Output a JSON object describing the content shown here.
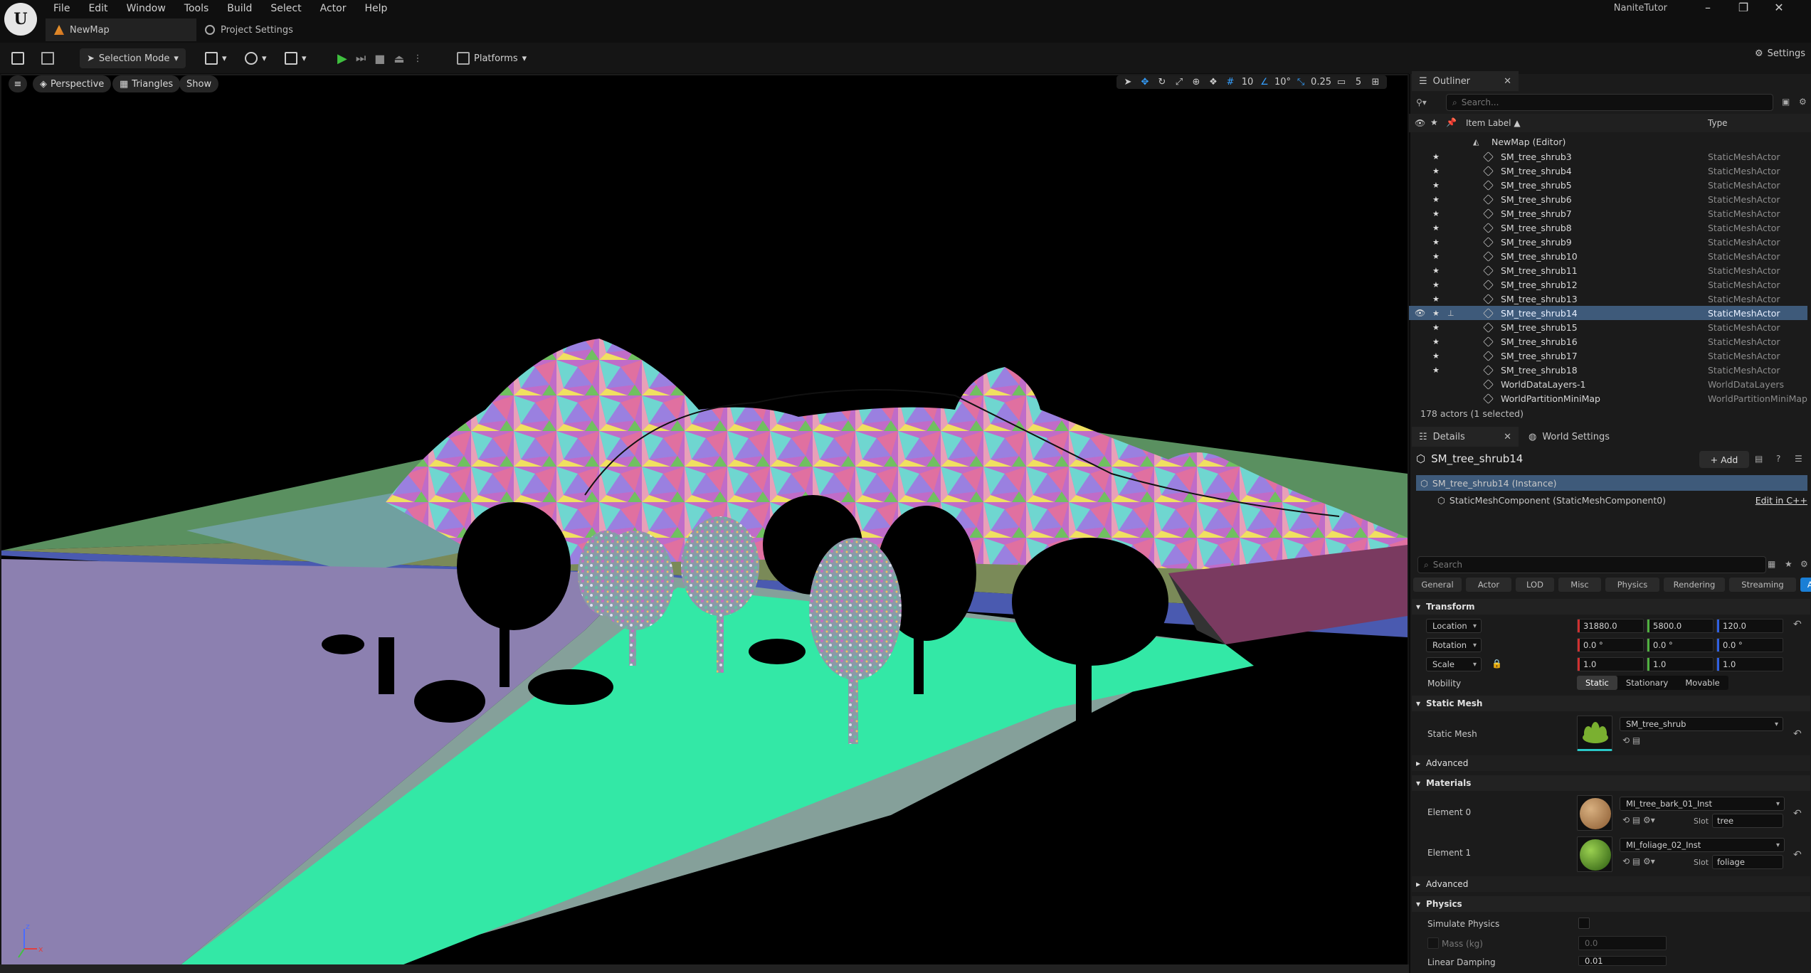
{
  "menu": [
    "File",
    "Edit",
    "Window",
    "Tools",
    "Build",
    "Select",
    "Actor",
    "Help"
  ],
  "project_name": "NaniteTutor",
  "window_controls": [
    "–",
    "❐",
    "✕"
  ],
  "tabs": {
    "map": "NewMap",
    "project_settings": "Project Settings"
  },
  "toolbar": {
    "selection_mode": "Selection Mode",
    "platforms": "Platforms",
    "settings": "Settings"
  },
  "viewport": {
    "perspective": "Perspective",
    "view_mode": "Triangles",
    "show": "Show",
    "grid_snap": "10",
    "rot_snap": "10°",
    "scale_snap": "0.25",
    "cam_speed": "5",
    "axis_z": "z",
    "axis_x": "x"
  },
  "outliner": {
    "tab": "Outliner",
    "search_placeholder": "Search...",
    "col_label": "Item Label ▲",
    "col_type": "Type",
    "root": "NewMap (Editor)",
    "rows": [
      {
        "label": "SM_tree_shrub3",
        "type": "StaticMeshActor"
      },
      {
        "label": "SM_tree_shrub4",
        "type": "StaticMeshActor"
      },
      {
        "label": "SM_tree_shrub5",
        "type": "StaticMeshActor"
      },
      {
        "label": "SM_tree_shrub6",
        "type": "StaticMeshActor"
      },
      {
        "label": "SM_tree_shrub7",
        "type": "StaticMeshActor"
      },
      {
        "label": "SM_tree_shrub8",
        "type": "StaticMeshActor"
      },
      {
        "label": "SM_tree_shrub9",
        "type": "StaticMeshActor"
      },
      {
        "label": "SM_tree_shrub10",
        "type": "StaticMeshActor"
      },
      {
        "label": "SM_tree_shrub11",
        "type": "StaticMeshActor"
      },
      {
        "label": "SM_tree_shrub12",
        "type": "StaticMeshActor"
      },
      {
        "label": "SM_tree_shrub13",
        "type": "StaticMeshActor"
      },
      {
        "label": "SM_tree_shrub14",
        "type": "StaticMeshActor"
      },
      {
        "label": "SM_tree_shrub15",
        "type": "StaticMeshActor"
      },
      {
        "label": "SM_tree_shrub16",
        "type": "StaticMeshActor"
      },
      {
        "label": "SM_tree_shrub17",
        "type": "StaticMeshActor"
      },
      {
        "label": "SM_tree_shrub18",
        "type": "StaticMeshActor"
      },
      {
        "label": "WorldDataLayers-1",
        "type": "WorldDataLayers"
      },
      {
        "label": "WorldPartitionMiniMap",
        "type": "WorldPartitionMiniMap"
      }
    ],
    "status": "178 actors (1 selected)"
  },
  "details": {
    "tab": "Details",
    "world_settings_tab": "World Settings",
    "actor_name": "SM_tree_shrub14",
    "add_button": "+ Add",
    "instance": "SM_tree_shrub14 (Instance)",
    "component": "StaticMeshComponent (StaticMeshComponent0)",
    "edit_cpp": "Edit in C++",
    "search_placeholder": "Search",
    "filters": [
      "General",
      "Actor",
      "LOD",
      "Misc",
      "Physics",
      "Rendering",
      "Streaming",
      "All"
    ],
    "transform": {
      "section": "Transform",
      "location_label": "Location",
      "rotation_label": "Rotation",
      "scale_label": "Scale",
      "location": [
        "31880.0",
        "5800.0",
        "120.0"
      ],
      "rotation": [
        "0.0 °",
        "0.0 °",
        "0.0 °"
      ],
      "scale": [
        "1.0",
        "1.0",
        "1.0"
      ],
      "mobility_label": "Mobility",
      "mobility": [
        "Static",
        "Stationary",
        "Movable"
      ]
    },
    "static_mesh": {
      "section": "Static Mesh",
      "label": "Static Mesh",
      "value": "SM_tree_shrub"
    },
    "advanced": "Advanced",
    "materials": {
      "section": "Materials",
      "elements": [
        {
          "label": "Element 0",
          "value": "MI_tree_bark_01_Inst",
          "slot_label": "Slot",
          "slot": "tree"
        },
        {
          "label": "Element 1",
          "value": "MI_foliage_02_Inst",
          "slot_label": "Slot",
          "slot": "foliage"
        }
      ]
    },
    "physics": {
      "section": "Physics",
      "simulate": "Simulate Physics",
      "mass_label": "Mass (kg)",
      "mass": "0.0",
      "linear_damping": "Linear Damping",
      "linear_damping_value": "0.01"
    }
  },
  "colors": {
    "accent": "#1a7fd6",
    "selection": "#3e5a7a",
    "play": "#3fbf3f",
    "ground": "#33e8a6"
  }
}
